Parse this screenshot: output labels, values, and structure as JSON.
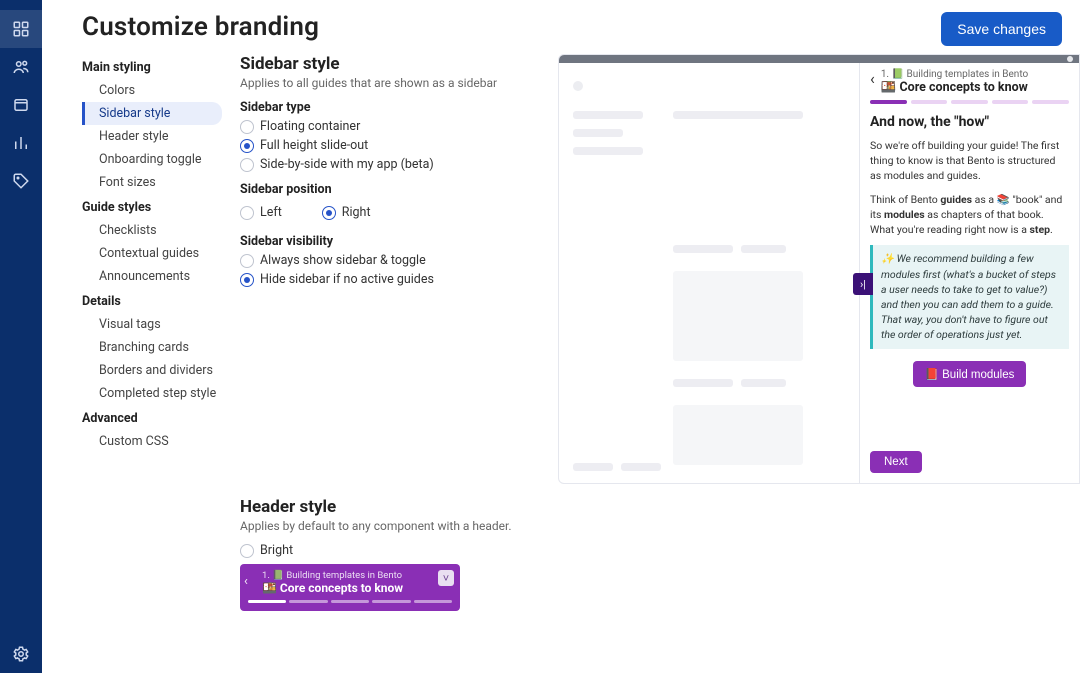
{
  "page": {
    "title": "Customize branding",
    "save_label": "Save changes"
  },
  "nav": {
    "groups": [
      {
        "label": "Main styling",
        "items": [
          "Colors",
          "Sidebar style",
          "Header style",
          "Onboarding toggle",
          "Font sizes"
        ],
        "active_index": 1
      },
      {
        "label": "Guide styles",
        "items": [
          "Checklists",
          "Contextual guides",
          "Announcements"
        ]
      },
      {
        "label": "Details",
        "items": [
          "Visual tags",
          "Branching cards",
          "Borders and dividers",
          "Completed step style"
        ]
      },
      {
        "label": "Advanced",
        "items": [
          "Custom CSS"
        ]
      }
    ]
  },
  "sidebar_style": {
    "heading": "Sidebar style",
    "sub": "Applies to all guides that are shown as a sidebar",
    "type_label": "Sidebar type",
    "type_options": [
      "Floating container",
      "Full height slide-out",
      "Side-by-side with my app (beta)"
    ],
    "type_selected": 1,
    "pos_label": "Sidebar position",
    "pos_options": [
      "Left",
      "Right"
    ],
    "pos_selected": 1,
    "vis_label": "Sidebar visibility",
    "vis_options": [
      "Always show sidebar & toggle",
      "Hide sidebar if no active guides"
    ],
    "vis_selected": 1
  },
  "header_style": {
    "heading": "Header style",
    "sub": "Applies by default to any component with a header.",
    "options": [
      "Bright"
    ],
    "selected": null,
    "mini": {
      "breadcrumb": "1. 📗 Building templates in Bento",
      "title": "🍱 Core concepts to know"
    }
  },
  "preview": {
    "breadcrumb": "1. 📗 Building templates in Bento",
    "title": "🍱 Core concepts to know",
    "heading": "And now, the \"how\"",
    "para1": "So we're off building your guide! The first thing to know is that Bento is structured as modules and guides.",
    "para2_pre": "Think of Bento ",
    "para2_b1": "guides",
    "para2_mid1": " as a 📚 \"book\" and its ",
    "para2_b2": "modules",
    "para2_mid2": " as chapters of that book. What you're reading right now is a ",
    "para2_b3": "step",
    "para2_end": ".",
    "callout": "✨ We recommend building a few modules first (what's a bucket of steps a user needs to take to get to value?) and then you can add them to a guide. That way, you don't have to figure out the order of operations just yet.",
    "cta": "📕 Build modules",
    "next": "Next"
  }
}
